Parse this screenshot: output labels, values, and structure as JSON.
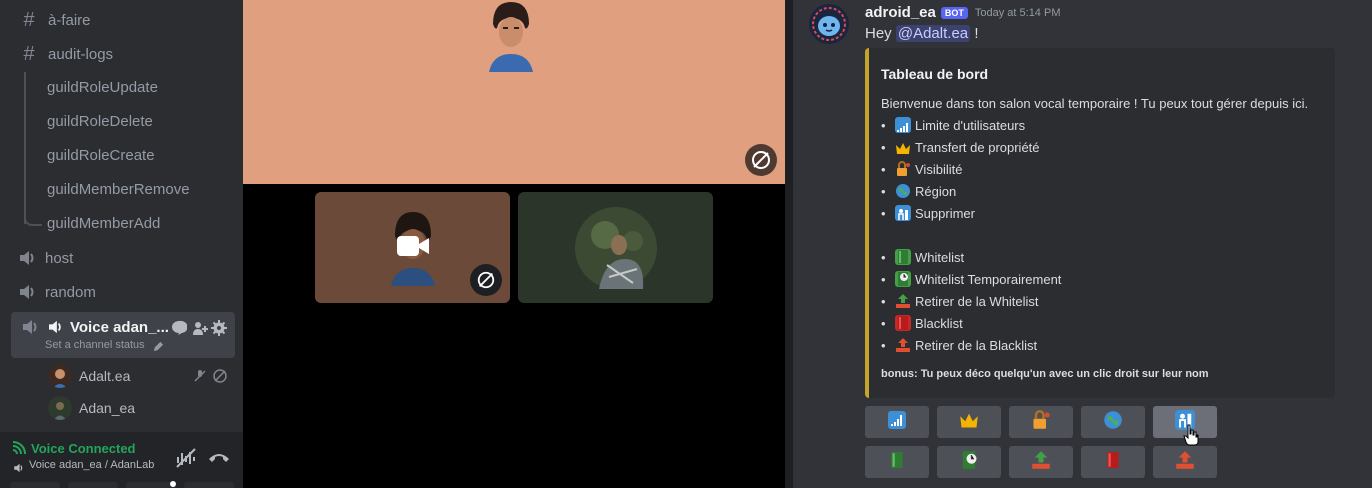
{
  "sidebar": {
    "channels_top": [
      {
        "label": "à-faire"
      },
      {
        "label": "audit-logs"
      }
    ],
    "threads": [
      {
        "label": "guildRoleUpdate"
      },
      {
        "label": "guildRoleDelete"
      },
      {
        "label": "guildRoleCreate"
      },
      {
        "label": "guildMemberRemove"
      },
      {
        "label": "guildMemberAdd"
      }
    ],
    "voice_channels": [
      {
        "label": "host"
      },
      {
        "label": "random"
      }
    ],
    "active_voice": {
      "label": "Voice adan_...",
      "status": "Set a channel status"
    },
    "voice_users": [
      {
        "name": "Adalt.ea"
      },
      {
        "name": "Adan_ea"
      }
    ],
    "voice_panel": {
      "status": "Voice Connected",
      "location": "Voice adan_ea / AdanLab",
      "status_color": "#23a55a"
    }
  },
  "message": {
    "username": "adroid_ea",
    "bot_tag": "BOT",
    "timestamp": "Today at 5:14 PM",
    "greeting": "Hey",
    "mention": "@Adalt.ea",
    "after": "!",
    "embed": {
      "accent": "#c4a52a",
      "title": "Tableau de bord",
      "description": "Bienvenue dans ton salon vocal temporaire ! Tu peux tout gérer depuis ici.",
      "items_group1": [
        {
          "label": "Limite d'utilisateurs",
          "icon": "signal-bars-icon"
        },
        {
          "label": "Transfert de propriété",
          "icon": "crown-icon"
        },
        {
          "label": "Visibilité",
          "icon": "lock-key-icon"
        },
        {
          "label": "Région",
          "icon": "globe-icon"
        },
        {
          "label": "Supprimer",
          "icon": "person-exit-icon"
        }
      ],
      "items_group2": [
        {
          "label": "Whitelist",
          "icon": "green-book-icon"
        },
        {
          "label": "Whitelist Temporairement",
          "icon": "book-clock-icon"
        },
        {
          "label": "Retirer de la Whitelist",
          "icon": "tray-up-icon"
        },
        {
          "label": "Blacklist",
          "icon": "red-book-icon"
        },
        {
          "label": "Retirer de la Blacklist",
          "icon": "tray-red-icon"
        }
      ],
      "footer": "bonus: Tu peux déco quelqu'un avec un clic droit sur leur nom"
    }
  }
}
